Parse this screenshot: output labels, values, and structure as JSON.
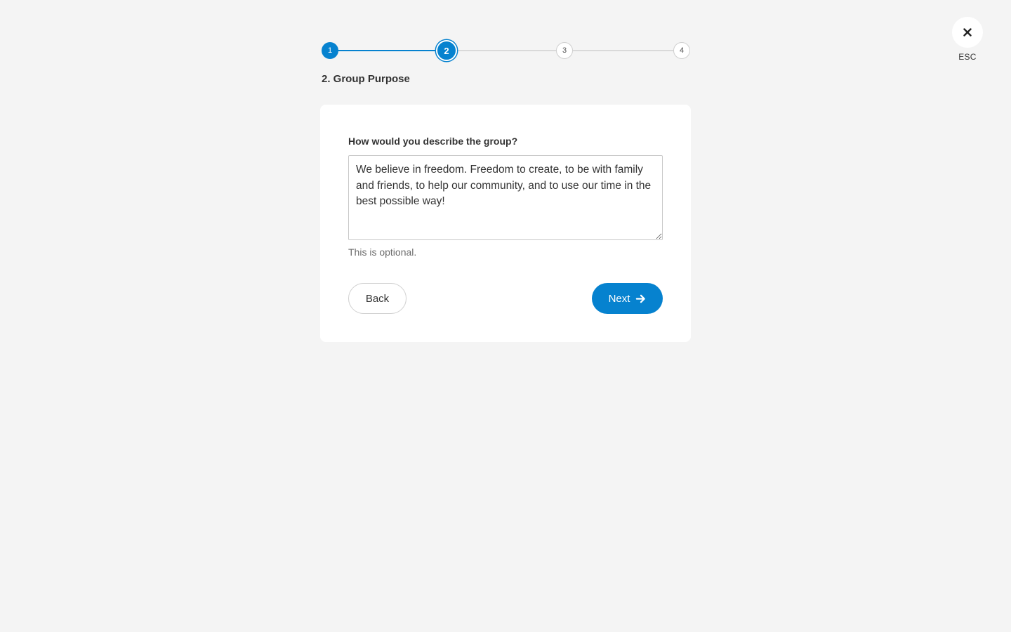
{
  "close": {
    "label": "ESC",
    "icon": "close-icon"
  },
  "stepper": {
    "steps": [
      {
        "number": "1",
        "state": "done"
      },
      {
        "number": "2",
        "state": "current"
      },
      {
        "number": "3",
        "state": "todo"
      },
      {
        "number": "4",
        "state": "todo"
      }
    ],
    "title": "2. Group Purpose"
  },
  "form": {
    "question": "How would you describe the group?",
    "description_value": "We believe in freedom. Freedom to create, to be with family and friends, to help our community, and to use our time in the best possible way!",
    "hint": "This is optional."
  },
  "actions": {
    "back_label": "Back",
    "next_label": "Next",
    "next_icon": "arrow-right-icon"
  },
  "colors": {
    "accent": "#0682cf",
    "background": "#f4f4f4",
    "card": "#ffffff"
  }
}
